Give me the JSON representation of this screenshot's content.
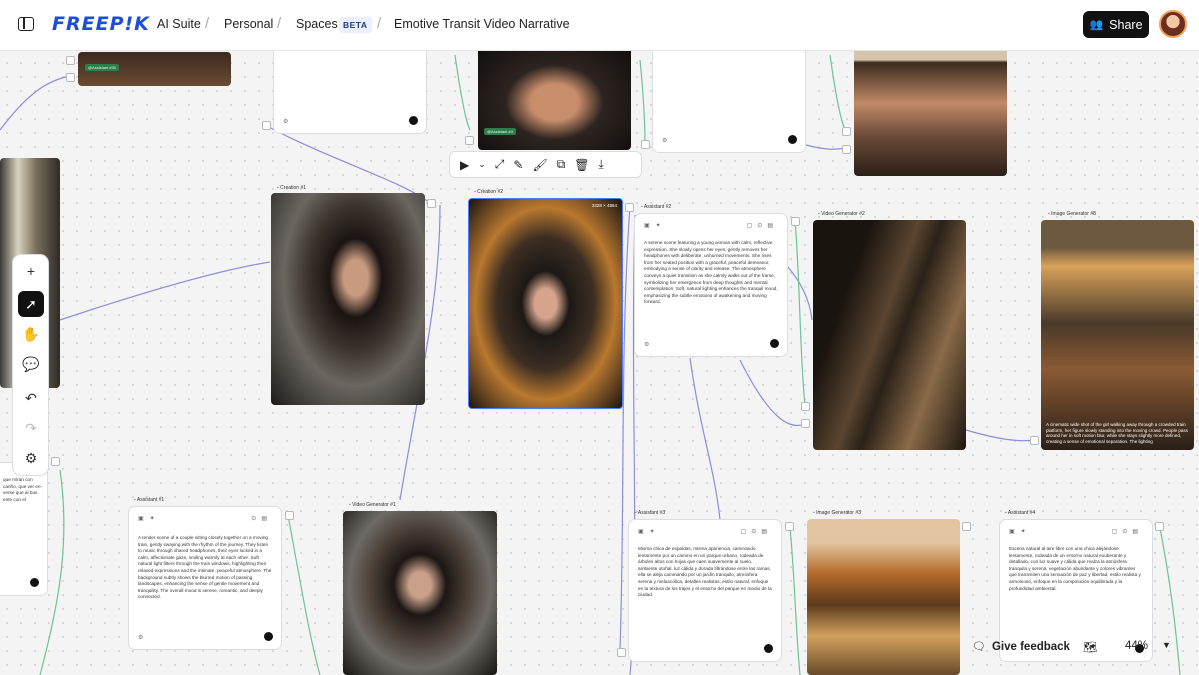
{
  "header": {
    "brand": "FREEP!K",
    "crumbs": [
      "AI Suite",
      "Personal",
      "Spaces"
    ],
    "beta_badge": "BETA",
    "project_title": "Emotive Transit Video Narrative",
    "share_label": "Share"
  },
  "toolbar": {
    "icons": [
      "play-icon",
      "chevron-down-icon",
      "expand-icon",
      "edit-icon",
      "brush-icon",
      "copy-icon",
      "trash-icon",
      "download-icon"
    ]
  },
  "tools": {
    "icons": [
      "plus-icon",
      "cursor-icon",
      "hand-icon",
      "comment-icon",
      "undo-icon",
      "redo-icon",
      "settings-icon"
    ]
  },
  "nodes": {
    "creation1": {
      "label": "Creation #1"
    },
    "creation2": {
      "label": "Creation #2",
      "resolution": "3328 × 4864"
    },
    "assistant2": {
      "label": "Assistant #2",
      "text": "A serene scene featuring a young woman with calm, reflective expression. She slowly opens her eyes, gently removes her headphones with deliberate, unhurried movements. She rises from her seated position with a graceful, peaceful demeanor, embodying a sense of clarity and release. The atmosphere conveys a quiet transition as she calmly walks out of the frame, symbolizing her emergence from deep thoughts and mental contemplation. Soft, natural lighting enhances the tranquil mood, emphasizing the subtle emotions of awakening and moving forward."
    },
    "videogen2": {
      "label": "Video Generator #2"
    },
    "imagegen8": {
      "label": "Image Generator #8",
      "caption": "A cinematic wide shot of the girl walking away through a crowded train platform, her figure slowly standing into the moving crowd. People pass around her in soft motion blur, while she stays slightly more defined, creating a sense of emotional separation. The lighting"
    },
    "assistant1": {
      "label": "Assistant #1",
      "text": "A tender scene of a couple sitting closely together on a moving train, gently swaying with the rhythm of the journey. They listen to music through shared headphones, their eyes locked in a calm, affectionate gaze, smiling warmly at each other. Soft natural light filters through the train windows, highlighting their relaxed expressions and the intimate, peaceful atmosphere. The background subtly shows the blurred motion of passing landscapes, enhancing the sense of gentle movement and tranquility. The overall mood is serene, romantic, and deeply connected."
    },
    "videogen1": {
      "label": "Video Generator #1"
    },
    "assistant3": {
      "label": "Assistant #3",
      "text": "Misma chica de espaldas, misma apariencia, caminando lentamente por un camino en un parque urbano, rodeada de árboles altos con hojas que caen suavemente al suelo, ambiente otoñal, luz cálida y dorada filtrándose entre las ramas, ella se aleja caminando por un jardín tranquilo, atmósfera serena y melancólica, detalles realistas, estilo natural, enfoque en la textura de los trajes y el entorno del parque en medio de la ciudad."
    },
    "imagegen3": {
      "label": "Image Generator #3"
    },
    "assistant4": {
      "label": "Assistant #4",
      "text": "Escena natural al aire libre con una chica alejándose lentamente, rodeada de un entorno natural exuberante y detallado, con luz suave y cálida que realza la atmósfera tranquila y serena, vegetación abundante y colores vibrantes que transmiten una sensación de paz y libertad, estilo realista y armonioso, enfoque en la composición equilibrada y la profundidad ambiental."
    },
    "left_partial": {
      "text": "que miran con cariño, que ver en- verse que al bus ente con el"
    },
    "tag_a": "@Assistant #30",
    "tag_b": "@Assistant #4"
  },
  "bottom": {
    "feedback_label": "Give feedback",
    "zoom": "44%"
  }
}
